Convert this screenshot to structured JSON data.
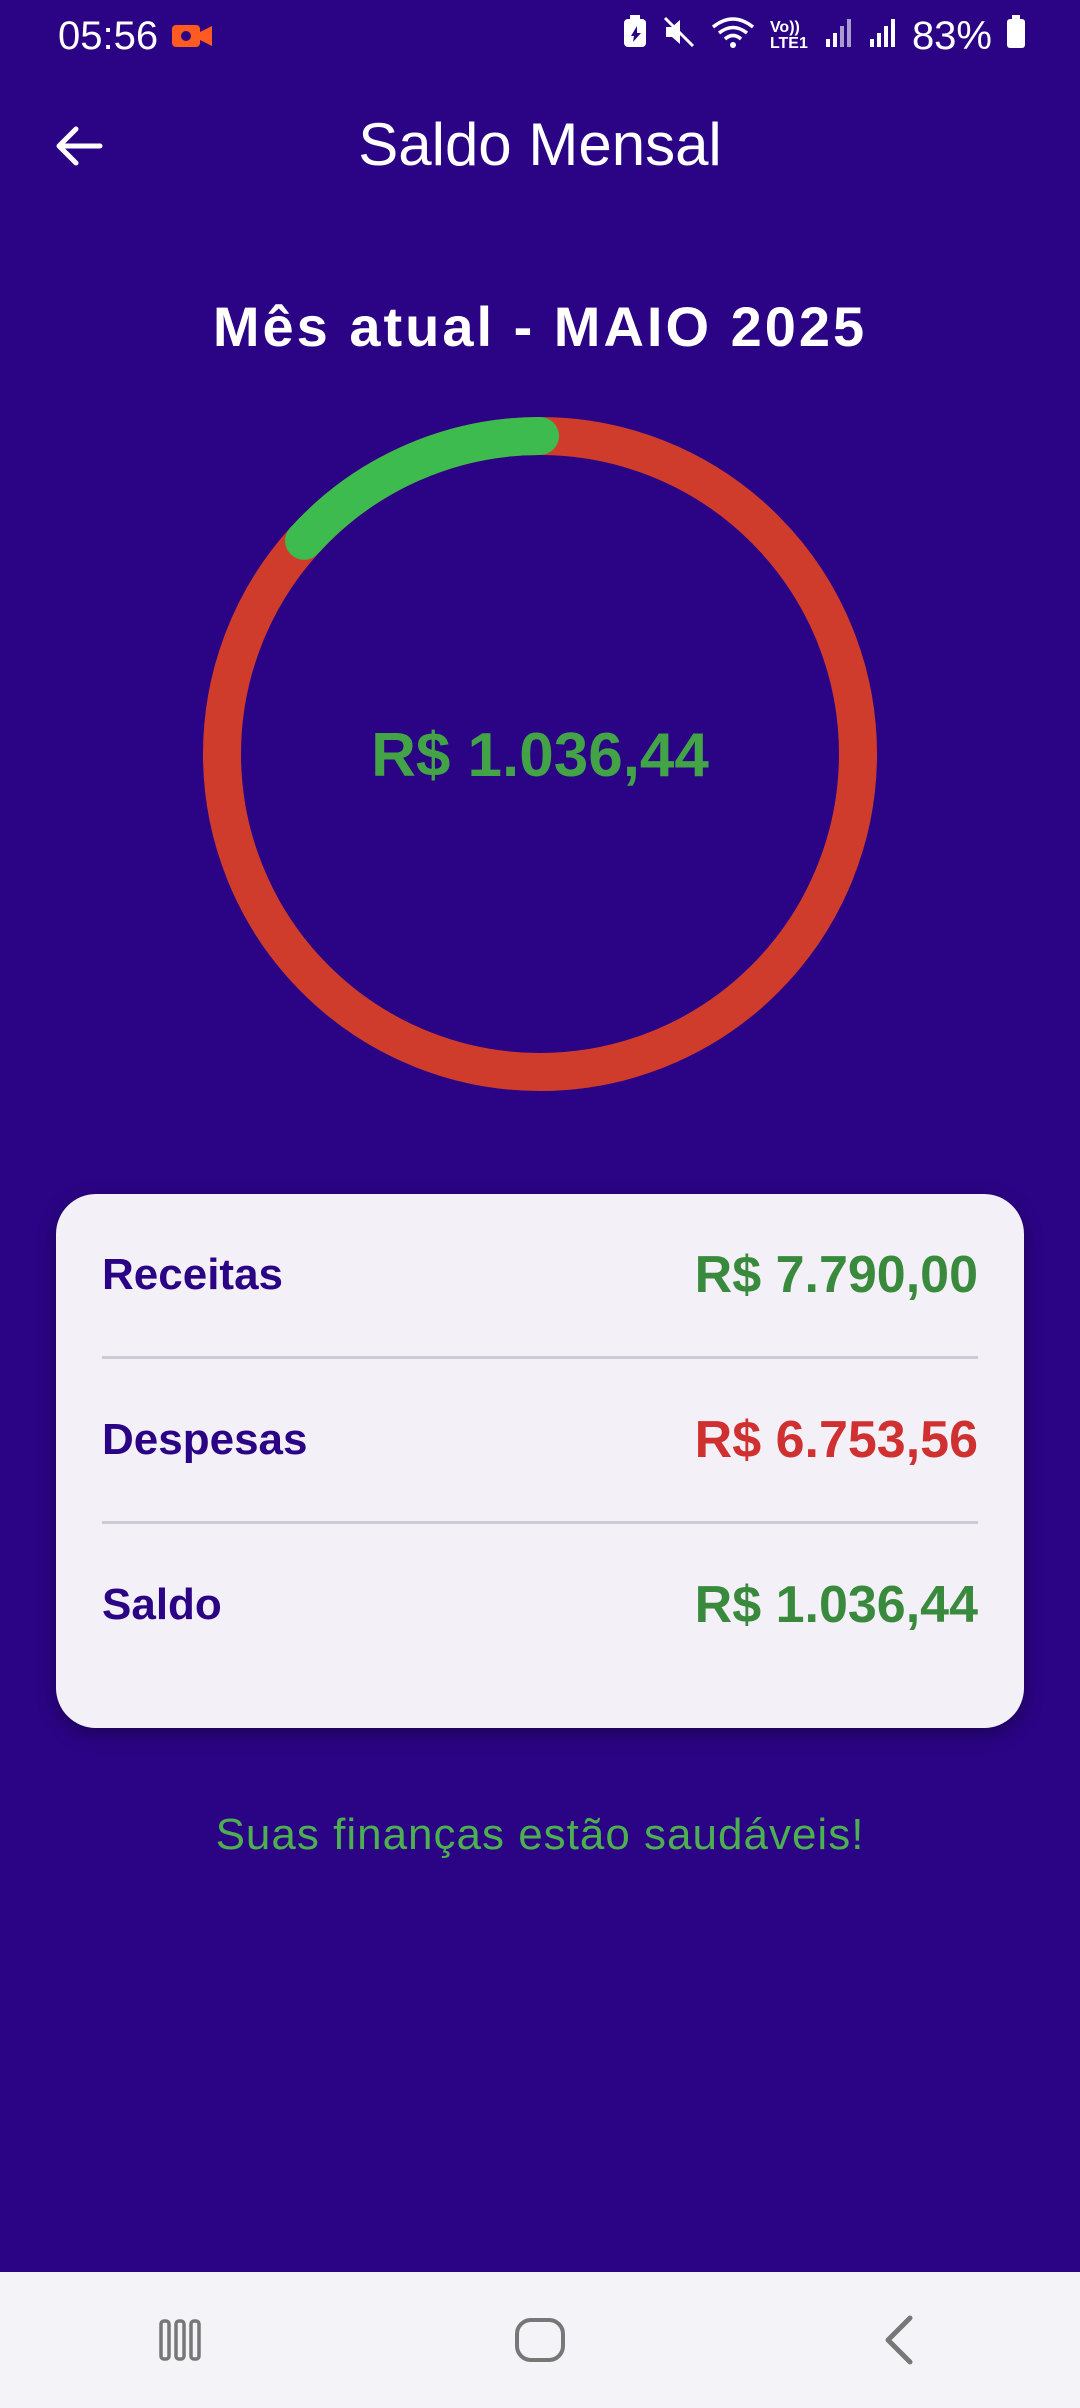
{
  "status_bar": {
    "time": "05:56",
    "battery": "83%",
    "icons": [
      "recording-icon",
      "battery-saver-icon",
      "mute-icon",
      "wifi-icon",
      "volte-icon",
      "signal-icon",
      "signal-icon-2",
      "battery-icon"
    ],
    "volte_label": "Vo)) LTE1"
  },
  "app_bar": {
    "title": "Saldo Mensal",
    "back_icon": "arrow-left-icon"
  },
  "month_label": "Mês atual - MAIO 2025",
  "donut": {
    "center_value": "R$ 1.036,44",
    "income": 7790.0,
    "expenses": 6753.56,
    "colors": {
      "balance": "#3DBB4E",
      "expenses": "#D03C2C"
    }
  },
  "summary": {
    "rows": [
      {
        "label": "Receitas",
        "value": "R$ 7.790,00",
        "color": "#3A8A3E"
      },
      {
        "label": "Despesas",
        "value": "R$ 6.753,56",
        "color": "#CF3030"
      },
      {
        "label": "Saldo",
        "value": "R$ 1.036,44",
        "color": "#3A8A3E"
      }
    ]
  },
  "health_message": "Suas finanças estão saudáveis!",
  "colors": {
    "background": "#2B0485",
    "card": "#F4F0F8",
    "accent_green": "#43A447",
    "accent_red": "#CF3030"
  },
  "nav_bar": {
    "icons": [
      "recent-apps-icon",
      "home-icon",
      "back-nav-icon"
    ]
  }
}
